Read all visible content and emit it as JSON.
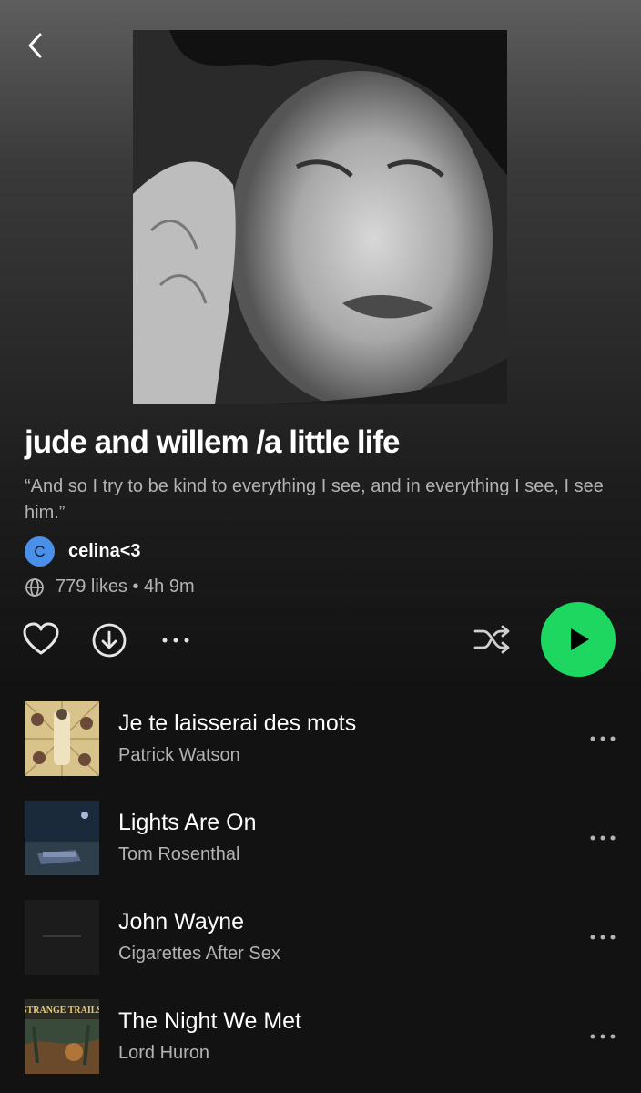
{
  "playlist": {
    "title": "jude and willem /a little life",
    "description": "“And so I try to be kind to everything I see, and in everything I see, I see him.”",
    "owner": {
      "initial": "C",
      "name": "celina<3"
    },
    "meta": "779 likes • 4h 9m"
  },
  "colors": {
    "accent": "#1ed760",
    "avatar": "#4a8fe8",
    "secondary_text": "#b3b3b3"
  },
  "icons": [
    "back-arrow-icon",
    "globe-icon",
    "heart-icon",
    "download-icon",
    "more-icon",
    "shuffle-icon",
    "play-icon"
  ],
  "tracks": [
    {
      "title": "Je te laisserai des mots",
      "artist": "Patrick Watson"
    },
    {
      "title": "Lights Are On",
      "artist": "Tom Rosenthal"
    },
    {
      "title": "John Wayne",
      "artist": "Cigarettes After Sex"
    },
    {
      "title": "The Night We Met",
      "artist": "Lord Huron",
      "art_text": "STRANGE TRAILS"
    }
  ]
}
